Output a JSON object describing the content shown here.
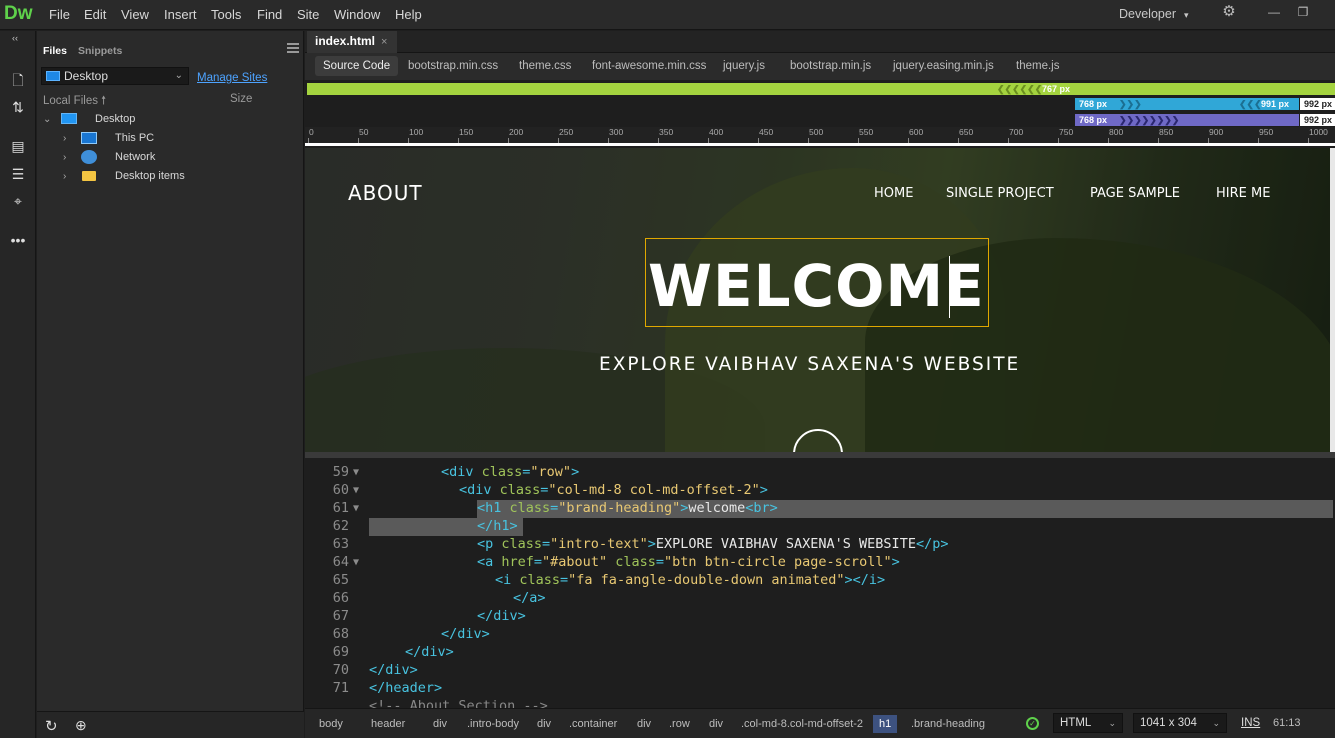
{
  "app": {
    "logo": "Dw",
    "workspace": "Developer"
  },
  "menu": [
    "File",
    "Edit",
    "View",
    "Insert",
    "Tools",
    "Find",
    "Site",
    "Window",
    "Help"
  ],
  "files_panel": {
    "collapse_glyph": "‹‹",
    "tabs": [
      "Files",
      "Snippets"
    ],
    "site": "Desktop",
    "manage_sites": "Manage Sites",
    "local_files": "Local Files",
    "size": "Size",
    "tree": [
      {
        "label": "Desktop",
        "icon": "desktop-icon"
      },
      {
        "label": "This PC",
        "icon": "computer-icon"
      },
      {
        "label": "Network",
        "icon": "network-icon"
      },
      {
        "label": "Desktop items",
        "icon": "folder-icon"
      }
    ]
  },
  "document_tab": {
    "name": "index.html",
    "close": "×"
  },
  "related_files": [
    "Source Code",
    "bootstrap.min.css",
    "theme.css",
    "font-awesome.min.css",
    "jquery.js",
    "bootstrap.min.js",
    "jquery.easing.min.js",
    "theme.js"
  ],
  "media_queries": {
    "green": "767 px",
    "blue_min": "768 px",
    "blue_max": "991 px",
    "blue_end": "992 px",
    "purple_min": "768 px",
    "purple_end": "992 px",
    "colors": {
      "green": "#a4d33f",
      "blue": "#30a7d7",
      "purple": "#6f69c6"
    }
  },
  "ruler": [
    "0",
    "50",
    "100",
    "150",
    "200",
    "250",
    "300",
    "350",
    "400",
    "450",
    "500",
    "550",
    "600",
    "650",
    "700",
    "750",
    "800",
    "850",
    "900",
    "950",
    "1000"
  ],
  "live_view": {
    "brand": "ABOUT",
    "nav": [
      "HOME",
      "SINGLE PROJECT",
      "PAGE SAMPLE",
      "HIRE ME"
    ],
    "heading": "WELCOME",
    "intro": "EXPLORE VAIBHAV SAXENA'S WEBSITE"
  },
  "code_lines": [
    {
      "n": "59",
      "fold": true
    },
    {
      "n": "60",
      "fold": true
    },
    {
      "n": "61",
      "fold": true
    },
    {
      "n": "62",
      "fold": false
    },
    {
      "n": "63",
      "fold": false
    },
    {
      "n": "64",
      "fold": true
    },
    {
      "n": "65",
      "fold": false
    },
    {
      "n": "66",
      "fold": false
    },
    {
      "n": "67",
      "fold": false
    },
    {
      "n": "68",
      "fold": false
    },
    {
      "n": "69",
      "fold": false
    },
    {
      "n": "70",
      "fold": false
    },
    {
      "n": "71",
      "fold": false
    }
  ],
  "code_text": {
    "l59": {
      "open": "<div ",
      "attr": "class",
      "eq": "=",
      "val": "\"row\"",
      "close": ">"
    },
    "l60": {
      "open": "<div ",
      "attr": "class",
      "eq": "=",
      "val": "\"col-md-8 col-md-offset-2\"",
      "close": ">"
    },
    "l61": {
      "open": "<h1 ",
      "attr": "class",
      "eq": "=",
      "val": "\"brand-heading\"",
      "close": ">",
      "text": "welcome",
      "br": "<br>"
    },
    "l62": {
      "tag": "</h1>"
    },
    "l63": {
      "open": "<p ",
      "attr": "class",
      "eq": "=",
      "val": "\"intro-text\"",
      "close": ">",
      "text": "EXPLORE VAIBHAV SAXENA'S WEBSITE",
      "end": "</p>"
    },
    "l64": {
      "open": "<a ",
      "attr": "href",
      "eq": "=",
      "val": "\"#about\"",
      "attr2": " class",
      "val2": "\"btn btn-circle page-scroll\"",
      "close": ">"
    },
    "l65": {
      "open": "<i ",
      "attr": "class",
      "eq": "=",
      "val": "\"fa fa-angle-double-down animated\"",
      "close": ">",
      "end": "</i>"
    },
    "l66": {
      "tag": "</a>"
    },
    "l67": {
      "tag": "</div>"
    },
    "l68": {
      "tag": "</div>"
    },
    "l69": {
      "tag": "</div>"
    },
    "l70": {
      "tag": "</div>"
    },
    "l71": {
      "tag": "</header>"
    },
    "l72": {
      "comment": "<!-- About Section -->"
    }
  },
  "status": {
    "breadcrumbs": [
      "body",
      "header",
      "div",
      ".intro-body",
      "div",
      ".container",
      "div",
      ".row",
      "div",
      ".col-md-8.col-md-offset-2",
      "h1",
      ".brand-heading"
    ],
    "doctype": "HTML",
    "size": "1041 x 304",
    "ins": "INS",
    "position": "61:13"
  }
}
